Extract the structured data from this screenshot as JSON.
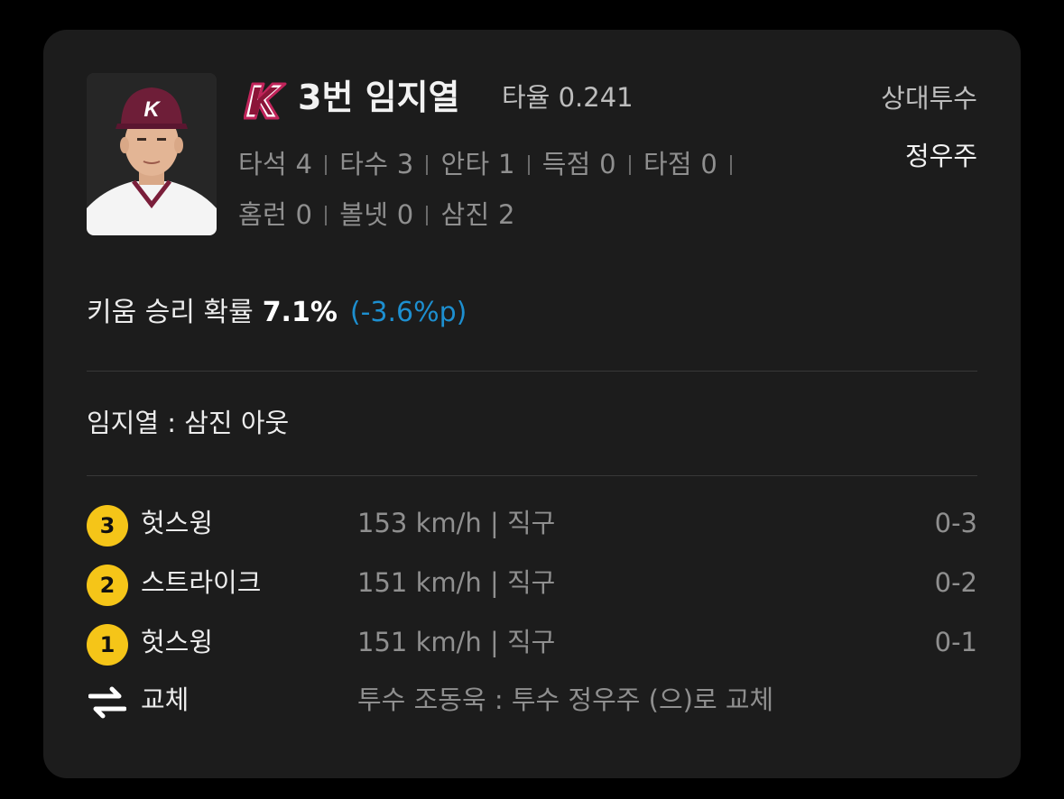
{
  "player": {
    "order_name": "3번 임지열",
    "avg": "타율 0.241",
    "team_logo_icon": "kiwoom-k-logo-icon",
    "photo_icon": "player-photo"
  },
  "stats": {
    "line1": [
      {
        "label": "타석 4"
      },
      {
        "label": "타수 3"
      },
      {
        "label": "안타 1"
      },
      {
        "label": "득점 0"
      },
      {
        "label": "타점 0"
      }
    ],
    "line2": [
      {
        "label": "홈런 0"
      },
      {
        "label": "볼넷 0"
      },
      {
        "label": "삼진 2"
      }
    ]
  },
  "opponent": {
    "label": "상대투수",
    "name": "정우주"
  },
  "win_probability": {
    "label": "키움 승리 확률",
    "value": "7.1%",
    "delta": "(-3.6%p)",
    "delta_color": "#1d8fd0"
  },
  "result": {
    "text": "임지열 : 삼진 아웃"
  },
  "pitches": [
    {
      "num": "3",
      "type": "헛스윙",
      "detail": "153 km/h | 직구",
      "count": "0-3"
    },
    {
      "num": "2",
      "type": "스트라이크",
      "detail": "151 km/h | 직구",
      "count": "0-2"
    },
    {
      "num": "1",
      "type": "헛스윙",
      "detail": "151 km/h | 직구",
      "count": "0-1"
    }
  ],
  "substitution": {
    "icon": "swap-arrows-icon",
    "type": "교체",
    "detail": "투수 조동욱 : 투수 정우주 (으)로 교체"
  },
  "colors": {
    "card_bg": "#1c1c1c",
    "badge": "#f5c518",
    "team_brand": "#8b1538"
  }
}
